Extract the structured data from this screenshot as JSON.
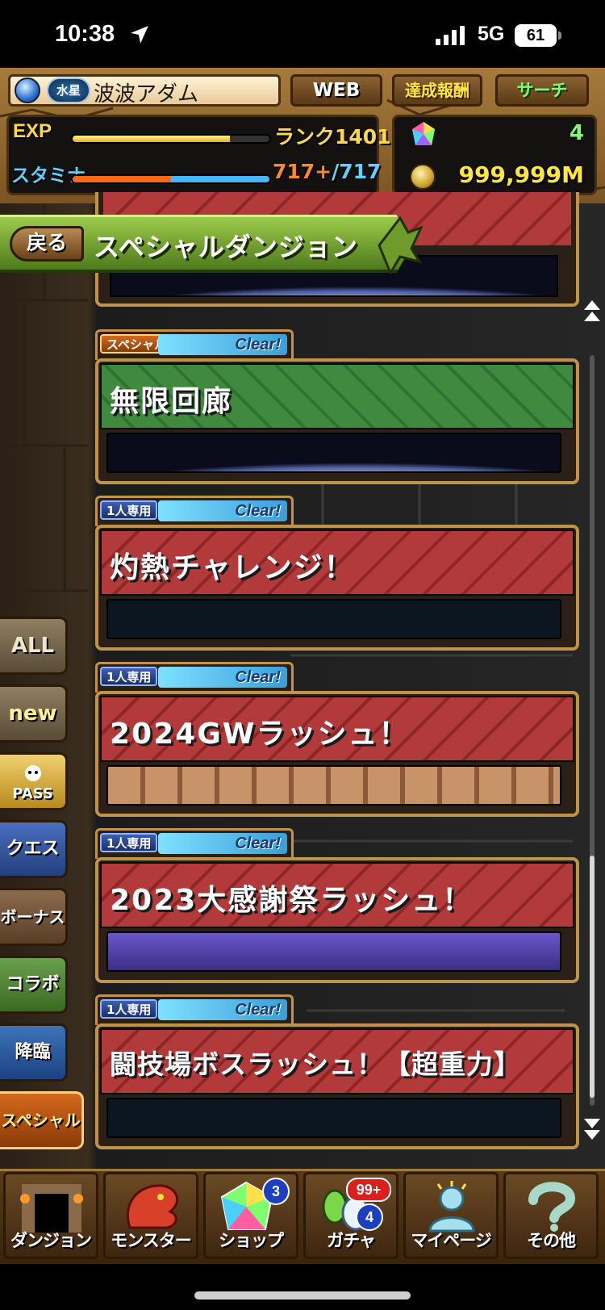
{
  "status_bar": {
    "time": "10:38",
    "network": "5G",
    "battery": "61"
  },
  "hud": {
    "title_badge": "水星",
    "player_name": "波波アダム",
    "buttons": {
      "web": "WEB",
      "reward": "達成報酬",
      "search": "サーチ"
    },
    "exp_label": "EXP",
    "exp_fraction": 0.8,
    "rank": "ランク1401",
    "stamina_label": "スタミナ",
    "stamina_fraction": 1.0,
    "stamina_current": "717+",
    "stamina_max": "/717",
    "magic_stones": "4",
    "coins": "999,999M"
  },
  "header": {
    "back_label": "戻る",
    "title": "スペシャルダンジョン"
  },
  "dungeons": [
    {
      "type": "スペシャル",
      "status": "Clear!",
      "title": "無限回廊"
    },
    {
      "type": "1人専用",
      "status": "Clear!",
      "title": "灼熱チャレンジ！"
    },
    {
      "type": "1人専用",
      "status": "Clear!",
      "title": "2024GWラッシュ！"
    },
    {
      "type": "1人専用",
      "status": "Clear!",
      "title": "2023大感謝祭ラッシュ！"
    },
    {
      "type": "1人専用",
      "status": "Clear!",
      "title": "闘技場ボスラッシュ！【超重力】"
    }
  ],
  "categories": {
    "all": "ALL",
    "new": "new",
    "pass": "PASS",
    "quest": "クエスト",
    "bonus": "ボーナス",
    "collab": "コラボ",
    "descent": "降臨",
    "special": "スペシャル"
  },
  "bottom_nav": {
    "dungeon": "ダンジョン",
    "monster": "モンスター",
    "shop": "ショップ",
    "shop_badge": "3",
    "gacha": "ガチャ",
    "gacha_badge_red": "99+",
    "gacha_badge_blue": "4",
    "mypage": "マイページ",
    "other": "その他"
  },
  "colors": {
    "accent_gold": "#c0924a",
    "clear_blue": "#7fe0ff",
    "header_green": "#4e7a1c"
  }
}
